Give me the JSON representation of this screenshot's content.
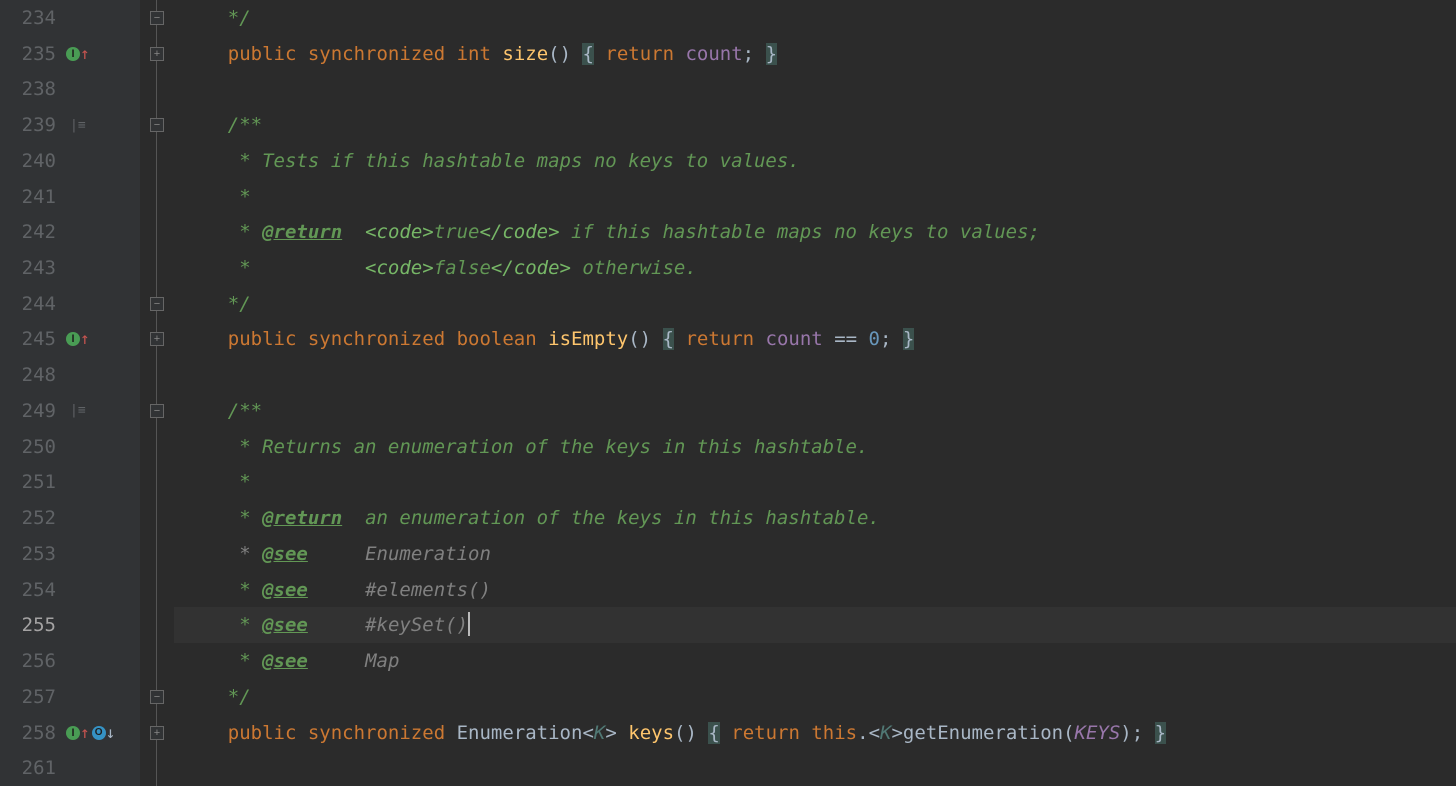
{
  "gutter": {
    "lines": [
      "234",
      "235",
      "238",
      "239",
      "240",
      "241",
      "242",
      "243",
      "244",
      "245",
      "248",
      "249",
      "250",
      "251",
      "252",
      "253",
      "254",
      "255",
      "256",
      "257",
      "258",
      "261"
    ],
    "active_line_index": 17
  },
  "icons": {
    "impl": "I",
    "override": "O"
  },
  "tokens": {
    "comment_end": "*/",
    "doc_start": "/**",
    "star": " * ",
    "star_only": " *",
    "indent": "    ",
    "public": "public",
    "synchronized": "synchronized",
    "int": "int",
    "boolean": "boolean",
    "return": "return",
    "this": "this",
    "size": "size",
    "isEmpty": "isEmpty",
    "keys": "keys",
    "count": "count",
    "getEnumeration": "getEnumeration",
    "KEYS": "KEYS",
    "Enumeration_type": "Enumeration",
    "K": "K",
    "zero": "0",
    "eq": "==",
    "semi": ";",
    "lparen": "(",
    "rparen": ")",
    "lbrace": "{",
    "rbrace": "}",
    "lt": "<",
    "gt": ">",
    "dot": "."
  },
  "doc": {
    "desc_isEmpty": "Tests if this hashtable maps no keys to values.",
    "return_tag": "@return",
    "see_tag": "@see",
    "code_open": "<code>",
    "code_close": "</code>",
    "true_txt": "true",
    "false_txt": "false",
    "ret_isEmpty_tail1": " if this hashtable maps no keys to values;",
    "ret_isEmpty_tail2": " otherwise.",
    "desc_keys": "Returns an enumeration of the keys in this hashtable.",
    "ret_keys": "an enumeration of the keys in this hashtable.",
    "see_Enumeration": "Enumeration",
    "see_elements": "#elements()",
    "see_keySet": "#keySet()",
    "see_Map": "Map"
  }
}
